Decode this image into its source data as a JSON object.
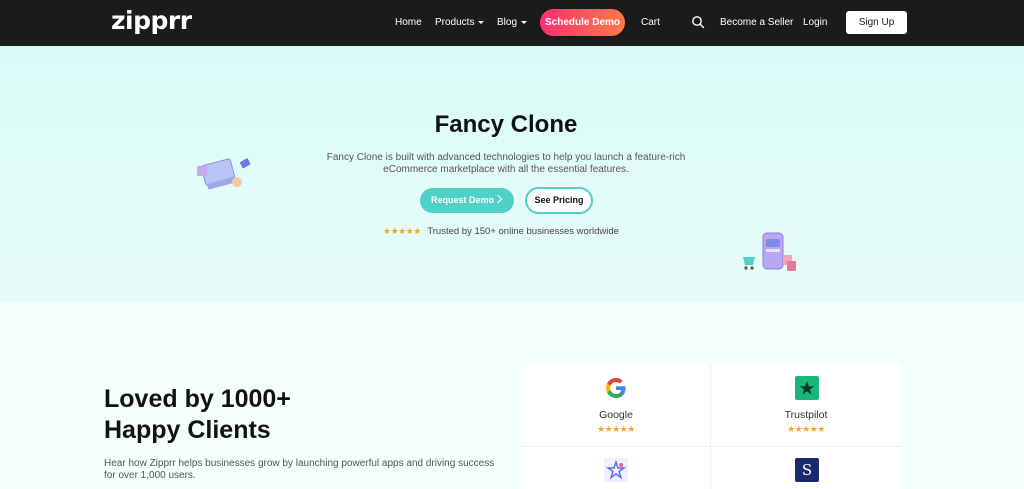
{
  "nav": {
    "logo": "zipprr",
    "links": {
      "home": "Home",
      "products": "Products",
      "blog": "Blog",
      "schedule_demo": "Schedule Demo",
      "cart": "Cart",
      "become_seller": "Become a Seller",
      "login": "Login",
      "signup": "Sign Up"
    }
  },
  "hero": {
    "title": "Fancy Clone",
    "description": "Fancy Clone is built with advanced technologies to help you launch a feature-rich eCommerce marketplace with all the essential features.",
    "request_demo": "Request Demo",
    "see_pricing": "See Pricing",
    "stars": "★★★★★",
    "trusted_text": "Trusted by 150+ online businesses worldwide"
  },
  "clients": {
    "title_line1": "Loved by 1000+",
    "title_line2": "Happy Clients",
    "description": "Hear how Zipprr helps businesses grow by launching powerful apps and driving success for over 1,000 users.",
    "reviews": [
      {
        "name": "Google",
        "stars": "★★★★★",
        "icon": "google-icon"
      },
      {
        "name": "Trustpilot",
        "stars": "★★★★★",
        "icon": "trustpilot-icon"
      },
      {
        "name": "",
        "stars": "",
        "icon": "capterra-icon"
      },
      {
        "name": "",
        "stars": "",
        "icon": "s-logo-icon",
        "letter": "S"
      }
    ]
  },
  "colors": {
    "nav_bg": "#1b1b1b",
    "accent_teal": "#4fd1c7",
    "schedule_gradient_start": "#ff2e72",
    "schedule_gradient_end": "#ff7a4a",
    "star": "#f5a623"
  }
}
